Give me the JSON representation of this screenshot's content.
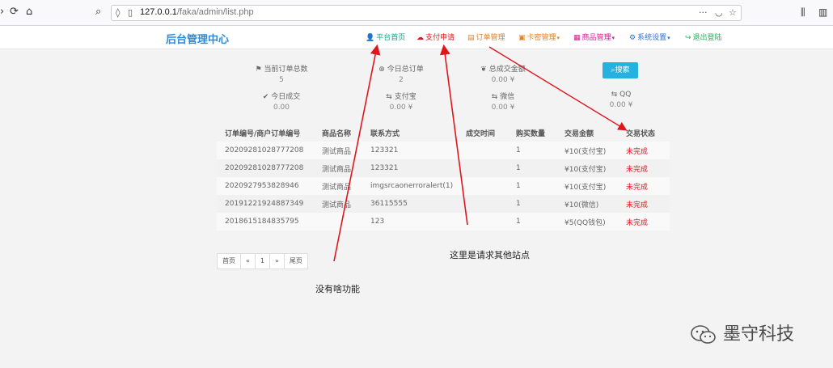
{
  "browser": {
    "url_host": "127.0.0.1",
    "url_path": "/faka/admin/list.php"
  },
  "app": {
    "brand": "后台管理中心",
    "nav": [
      {
        "label": "平台首页",
        "color": "#16a085",
        "icon": "user-icon"
      },
      {
        "label": "支付申请",
        "color": "#e0161d",
        "icon": "cloud-icon"
      },
      {
        "label": "订单管理",
        "color": "#e67e22",
        "icon": "list-icon"
      },
      {
        "label": "卡密管理",
        "color": "#e67e22",
        "icon": "card-icon",
        "dropdown": "▾"
      },
      {
        "label": "商品管理",
        "color": "#d81b8c",
        "icon": "grid-icon",
        "dropdown": "▾"
      },
      {
        "label": "系统设置",
        "color": "#2e6fd7",
        "icon": "gear-icon",
        "dropdown": "▾"
      },
      {
        "label": "退出登陆",
        "color": "#27ae60",
        "icon": "logout-icon"
      }
    ]
  },
  "stats": [
    {
      "label": "当前订单总数",
      "value": "5",
      "icon": "flag-icon",
      "glyph": "⚑"
    },
    {
      "label": "今日总订单",
      "value": "2",
      "icon": "plus-circle-icon",
      "glyph": "⊕"
    },
    {
      "label": "总成交金额",
      "value": "0.00 ¥",
      "icon": "leaf-icon",
      "glyph": "❦"
    },
    {
      "label": "今日成交",
      "value": "0.00",
      "icon": "check-icon",
      "glyph": "✔"
    },
    {
      "label": "支付宝",
      "value": "0.00 ¥",
      "icon": "retweet-icon",
      "glyph": "⇆"
    },
    {
      "label": "微信",
      "value": "0.00 ¥",
      "icon": "retweet-icon",
      "glyph": "⇆"
    },
    {
      "label": "QQ",
      "value": "0.00 ¥",
      "icon": "retweet-icon",
      "glyph": "⇆"
    }
  ],
  "search_label": "搜索",
  "table": {
    "headers": [
      "订单编号/商户订单编号",
      "商品名称",
      "联系方式",
      "成交时间",
      "购买数量",
      "交易金额",
      "交易状态"
    ],
    "rows": [
      [
        "20209281028777208",
        "测试商品",
        "123321",
        "",
        "1",
        "¥10(支付宝)",
        "未完成"
      ],
      [
        "20209281028777208",
        "测试商品",
        "123321",
        "",
        "1",
        "¥10(支付宝)",
        "未完成"
      ],
      [
        "2020927953828946",
        "测试商品",
        "imgsrcaonerroralert(1)",
        "",
        "1",
        "¥10(支付宝)",
        "未完成"
      ],
      [
        "20191221924887349",
        "测试商品",
        "36115555",
        "",
        "1",
        "¥10(微信)",
        "未完成"
      ],
      [
        "2018615184835795",
        "",
        "123",
        "",
        "1",
        "¥5(QQ钱包)",
        "未完成"
      ]
    ]
  },
  "pager": [
    "首页",
    "«",
    "1",
    "»",
    "尾页"
  ],
  "annotations": {
    "no_function": "没有啥功能",
    "other_site": "这里是请求其他站点"
  },
  "watermark": "墨守科技",
  "colors": {
    "brand": "#2e8bd7",
    "accent": "#27b1e0",
    "status_red": "#e0161d",
    "arrow": "#e0161d"
  }
}
